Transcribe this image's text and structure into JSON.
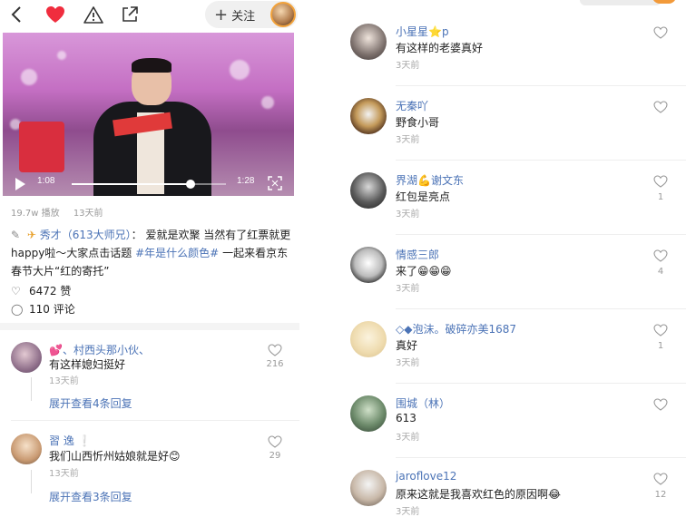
{
  "header": {
    "follow_label": "关注",
    "accent_color": "#f02d3e"
  },
  "video": {
    "current_time": "1:08",
    "duration": "1:28",
    "progress": 0.77
  },
  "meta": {
    "views": "19.7w 播放",
    "posted": "13天前"
  },
  "post": {
    "author": "秀才（613大师兄）",
    "separator": "：",
    "text_1": "爱就是欢聚 当然有了红票就更happy啦～大家点击话题",
    "hashtag": "#年是什么颜色#",
    "text_2": "一起来看京东春节大片“红的寄托”"
  },
  "stats": {
    "likes": "6472 赞",
    "comments": "110 评论"
  },
  "left_comments": [
    {
      "name": "💕、村西头那小伙、",
      "text": "有这样媳妇挺好",
      "time": "13天前",
      "like_count": "216",
      "more": "展开查看4条回复"
    },
    {
      "name": "習 逸 ❕",
      "text": "我们山西忻州姑娘就是好😊",
      "time": "13天前",
      "like_count": "29",
      "more": "展开查看3条回复"
    }
  ],
  "right_comments": [
    {
      "name": "小星星⭐p",
      "text": "有这样的老婆真好",
      "time": "3天前",
      "like_count": ""
    },
    {
      "name": "无秦吖",
      "text": "野食小哥",
      "time": "3天前",
      "like_count": ""
    },
    {
      "name": "界湖💪谢文东",
      "text": "红包是亮点",
      "time": "3天前",
      "like_count": "1"
    },
    {
      "name": "情感三郎",
      "text": "来了😁😁😁",
      "time": "3天前",
      "like_count": "4"
    },
    {
      "name": "◇◆泡沫。破碎亦美1687",
      "text": "真好",
      "time": "3天前",
      "like_count": "1"
    },
    {
      "name": "围城（林）",
      "text": "613",
      "time": "3天前",
      "like_count": ""
    },
    {
      "name": "jaroflove12",
      "text": "原来这就是我喜欢红色的原因啊😂",
      "time": "3天前",
      "like_count": "12"
    }
  ]
}
